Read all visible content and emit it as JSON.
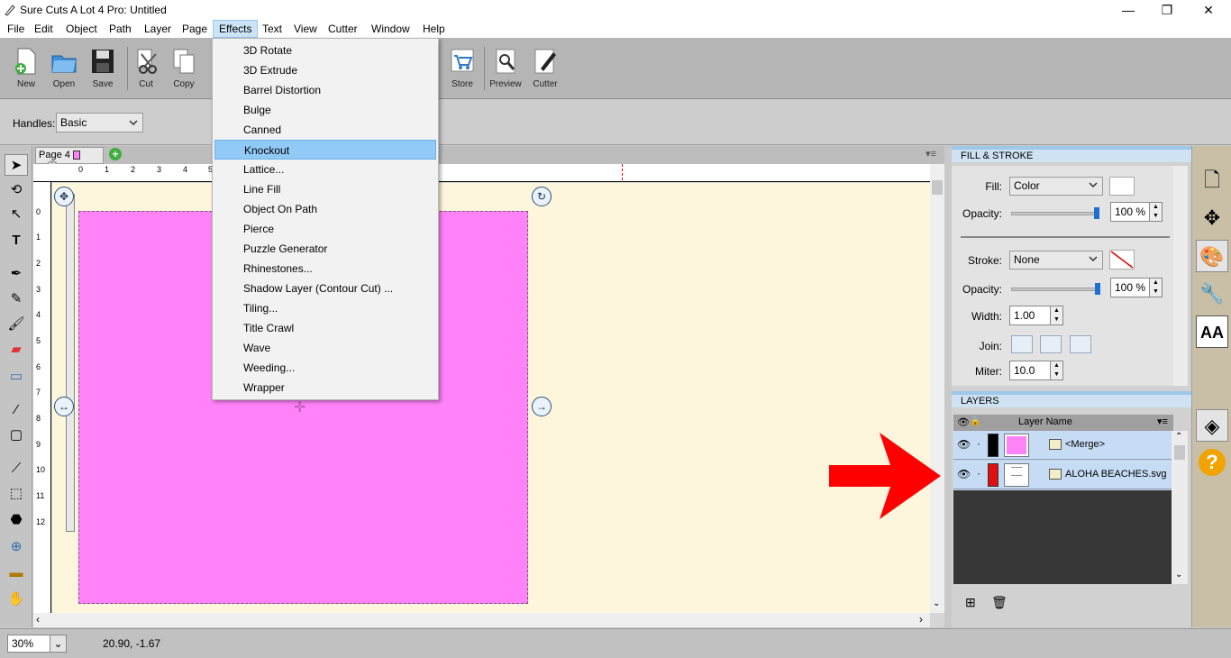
{
  "window": {
    "title": "Sure Cuts A Lot 4 Pro: Untitled",
    "min": "—",
    "max": "❐",
    "close": "✕"
  },
  "menubar": [
    "File",
    "Edit",
    "Object",
    "Path",
    "Layer",
    "Page",
    "Effects",
    "Text",
    "View",
    "Cutter",
    "Window",
    "Help"
  ],
  "toolbar": {
    "items": [
      {
        "label": "New",
        "icon": "new-document-icon"
      },
      {
        "label": "Open",
        "icon": "open-folder-icon"
      },
      {
        "label": "Save",
        "icon": "floppy-save-icon"
      },
      {
        "label": "Cut",
        "icon": "scissors-icon"
      },
      {
        "label": "Copy",
        "icon": "copy-icon"
      },
      {
        "label": "Store",
        "icon": "shopping-cart-icon"
      },
      {
        "label": "Preview",
        "icon": "magnifier-preview-icon"
      },
      {
        "label": "Cutter",
        "icon": "cutter-pen-icon"
      }
    ]
  },
  "handles": {
    "label": "Handles:",
    "value": "Basic"
  },
  "page_tab": {
    "label": "Page 4"
  },
  "ruler": {
    "h": [
      "0",
      "1",
      "2",
      "3",
      "4",
      "5"
    ],
    "v": [
      "0",
      "1",
      "2",
      "3",
      "4",
      "5",
      "6",
      "7",
      "8",
      "9",
      "10",
      "11",
      "12"
    ]
  },
  "effects_menu": {
    "items": [
      "3D Rotate",
      "3D Extrude",
      "Barrel Distortion",
      "Bulge",
      "Canned",
      "Knockout",
      "Lattice...",
      "Line Fill",
      "Object On Path",
      "Pierce",
      "Puzzle Generator",
      "Rhinestones...",
      "Shadow Layer (Contour Cut) ...",
      "Tiling...",
      "Title Crawl",
      "Wave",
      "Weeding...",
      "Wrapper"
    ],
    "highlighted": "Knockout"
  },
  "fill_stroke": {
    "header": "FILL & STROKE",
    "fill_label": "Fill:",
    "fill_value": "Color",
    "opacity_label": "Opacity:",
    "fill_opacity": "100 %",
    "stroke_label": "Stroke:",
    "stroke_value": "None",
    "stroke_opacity": "100 %",
    "width_label": "Width:",
    "width_value": "1.00",
    "join_label": "Join:",
    "miter_label": "Miter:",
    "miter_value": "10.0"
  },
  "layers": {
    "header": "LAYERS",
    "column": "Layer Name",
    "rows": [
      {
        "name": "<Merge>",
        "color": "#000000",
        "thumb": "#ff82f9"
      },
      {
        "name": "ALOHA BEACHES.svg",
        "color": "#e01010",
        "thumb": "#ffffff"
      }
    ]
  },
  "status": {
    "zoom": "30%",
    "coords": "20.90, -1.67"
  },
  "colors": {
    "pink": "#ff82f9",
    "canvas": "#fdf6dc",
    "accent": "#91c9f7",
    "arrow": "#ff0000"
  }
}
